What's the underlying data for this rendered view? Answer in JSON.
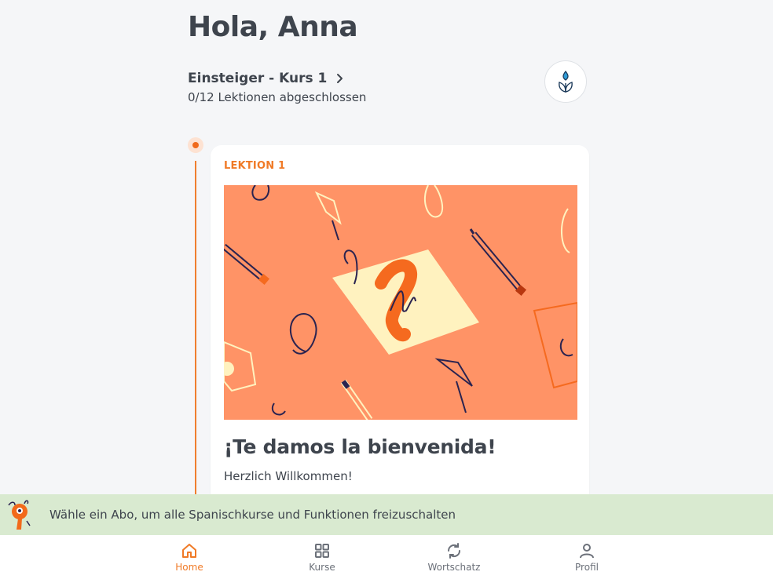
{
  "greeting": "Hola, Anna",
  "course": {
    "title": "Einsteiger - Kurs 1",
    "progress": "0/12 Lektionen abgeschlossen",
    "level_icon": "plant-sprout-icon"
  },
  "lesson": {
    "tag": "LEKTION 1",
    "title": "¡Te damos la bienvenida!",
    "subtitle": "Herzlich Willkommen!"
  },
  "promo": {
    "text": "Wähle ein Abo, um alle Spanischkurse und Funktionen freizuschalten",
    "icon": "key-mascot-icon"
  },
  "tabs": [
    {
      "label": "Home",
      "icon": "home-icon",
      "active": true
    },
    {
      "label": "Kurse",
      "icon": "grid-icon",
      "active": false
    },
    {
      "label": "Wortschatz",
      "icon": "refresh-icon",
      "active": false
    },
    {
      "label": "Profil",
      "icon": "person-icon",
      "active": false
    }
  ],
  "colors": {
    "accent": "#f07a26",
    "background": "#f5f6f8",
    "promo_bg": "#d9ead0",
    "illustration_bg": "#ff9366"
  }
}
